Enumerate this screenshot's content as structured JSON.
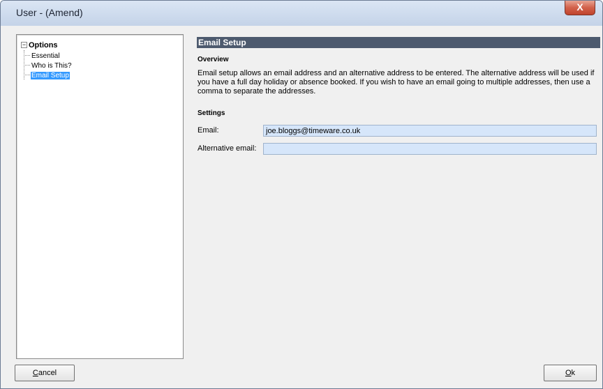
{
  "window": {
    "title": "User - (Amend)",
    "close_glyph": "X"
  },
  "tree": {
    "root_label": "Options",
    "expander_glyph": "−",
    "items": [
      {
        "label": "Essential",
        "selected": false
      },
      {
        "label": "Who is This?",
        "selected": false
      },
      {
        "label": "Email Setup",
        "selected": true
      }
    ]
  },
  "panel": {
    "header": "Email Setup",
    "overview_heading": "Overview",
    "overview_text": "Email setup allows an email address and an alternative address to be entered. The alternative address will be used if you have a full day holiday or absence booked. If you wish to have an email going to multiple addresses, then use a comma to separate the addresses.",
    "settings_heading": "Settings",
    "email_label": "Email:",
    "email_value": "joe.bloggs@timeware.co.uk",
    "alt_email_label": "Alternative email:",
    "alt_email_value": ""
  },
  "buttons": {
    "cancel_accel": "C",
    "cancel_rest": "ancel",
    "ok_accel": "O",
    "ok_rest": "k"
  },
  "colors": {
    "header_bg": "#4d5a6e",
    "input_bg": "#d6e6fa",
    "selection_bg": "#3399ff"
  }
}
